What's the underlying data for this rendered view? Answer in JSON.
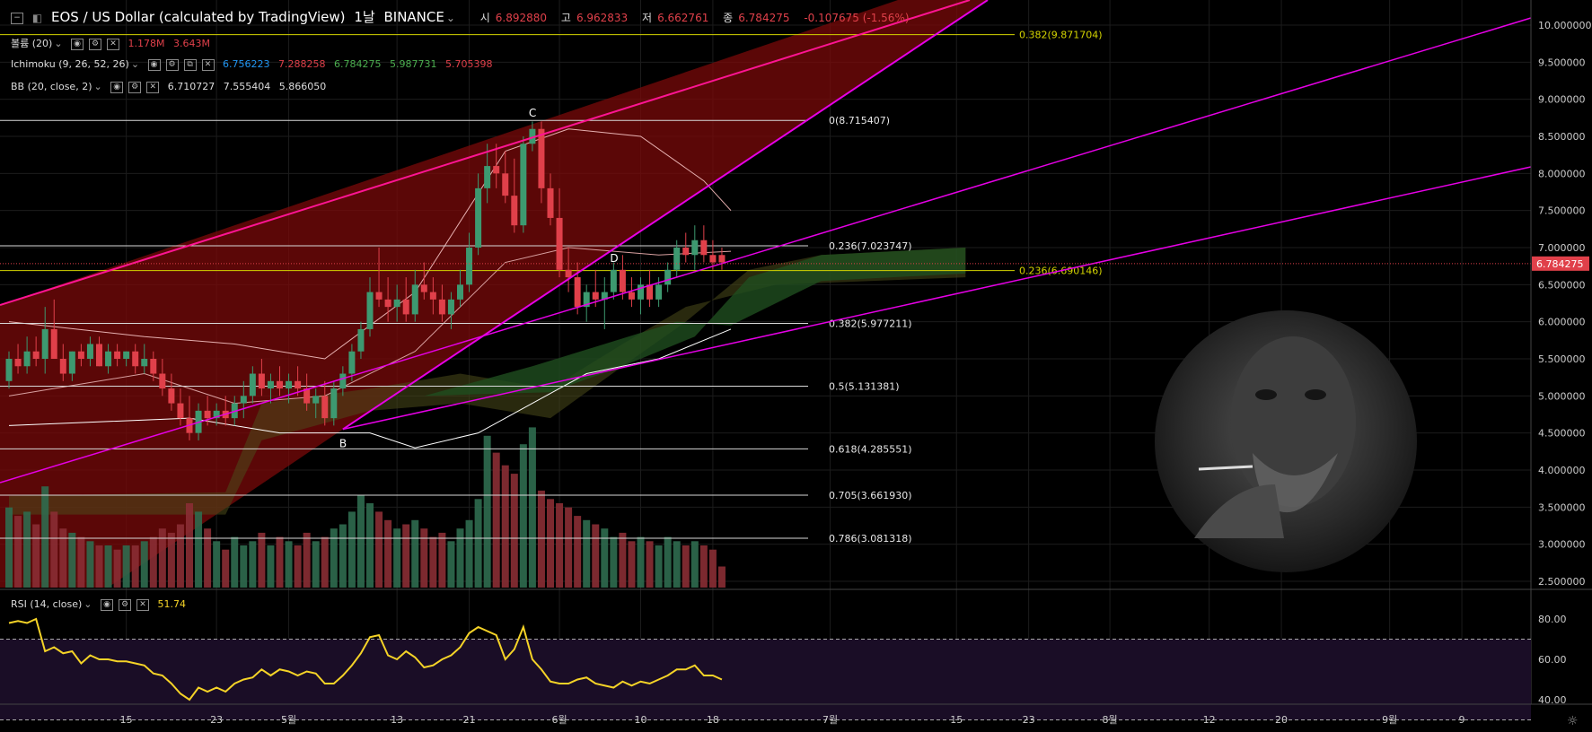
{
  "header": {
    "symbol": "EOS / US Dollar (calculated by TradingView)",
    "interval": "1날",
    "exchange": "BINANCE",
    "o_label": "시",
    "o_val": "6.892880",
    "h_label": "고",
    "h_val": "6.962833",
    "l_label": "저",
    "l_val": "6.662761",
    "c_label": "종",
    "c_val": "6.784275",
    "change": "-0.107675 (-1.56%)"
  },
  "indicators": {
    "volume_name": "볼륨 (20)",
    "volume_vals": [
      "1.178M",
      "3.643M"
    ],
    "ichimoku_name": "Ichimoku (9, 26, 52, 26)",
    "ichimoku_vals": [
      "6.756223",
      "7.288258",
      "6.784275",
      "5.987731",
      "5.705398"
    ],
    "bb_name": "BB (20, close, 2)",
    "bb_vals": [
      "6.710727",
      "7.555404",
      "5.866050"
    ],
    "rsi_name": "RSI (14, close)",
    "rsi_val": "51.74"
  },
  "colors": {
    "up": "#3d9970",
    "down": "#e0404a",
    "channel": "#ff1493",
    "trend": "#e600e6",
    "fib": "#d8d8d8",
    "fib2": "#d4d400",
    "rsi": "#f5d327",
    "ichi_cloud": "#1f4d1f",
    "price_tag": "#e0404a"
  },
  "chart_data": {
    "type": "candlestick",
    "price_axis": {
      "min": 2.5,
      "max": 10.0,
      "ticks": [
        "2.500000",
        "3.000000",
        "3.500000",
        "4.000000",
        "4.500000",
        "5.000000",
        "5.500000",
        "6.000000",
        "6.500000",
        "7.000000",
        "7.500000",
        "8.000000",
        "8.500000",
        "9.000000",
        "9.500000",
        "10.000000"
      ]
    },
    "time_axis": {
      "ticks": [
        {
          "label": "15",
          "i": 13
        },
        {
          "label": "23",
          "i": 23
        },
        {
          "label": "5월",
          "i": 31
        },
        {
          "label": "13",
          "i": 43
        },
        {
          "label": "21",
          "i": 51
        },
        {
          "label": "6월",
          "i": 61
        },
        {
          "label": "10",
          "i": 70
        },
        {
          "label": "18",
          "i": 78
        },
        {
          "label": "7월",
          "i": 91
        },
        {
          "label": "15",
          "i": 105
        },
        {
          "label": "23",
          "i": 113
        },
        {
          "label": "8월",
          "i": 122
        },
        {
          "label": "12",
          "i": 133
        },
        {
          "label": "20",
          "i": 141
        },
        {
          "label": "9월",
          "i": 153
        },
        {
          "label": "9",
          "i": 161
        }
      ]
    },
    "last_price": "6.784275",
    "candles": [
      [
        5.2,
        5.6,
        5.1,
        5.5
      ],
      [
        5.5,
        5.7,
        5.3,
        5.4
      ],
      [
        5.4,
        5.8,
        5.3,
        5.6
      ],
      [
        5.6,
        5.8,
        5.4,
        5.5
      ],
      [
        5.5,
        6.2,
        5.3,
        5.9
      ],
      [
        5.9,
        6.3,
        5.5,
        5.5
      ],
      [
        5.5,
        5.7,
        5.2,
        5.3
      ],
      [
        5.3,
        5.6,
        5.2,
        5.6
      ],
      [
        5.6,
        5.7,
        5.4,
        5.5
      ],
      [
        5.5,
        5.8,
        5.4,
        5.7
      ],
      [
        5.7,
        5.8,
        5.4,
        5.4
      ],
      [
        5.4,
        5.7,
        5.3,
        5.6
      ],
      [
        5.6,
        5.7,
        5.4,
        5.5
      ],
      [
        5.5,
        5.6,
        5.4,
        5.6
      ],
      [
        5.6,
        5.7,
        5.3,
        5.4
      ],
      [
        5.4,
        5.7,
        5.3,
        5.5
      ],
      [
        5.5,
        5.6,
        5.2,
        5.3
      ],
      [
        5.3,
        5.5,
        5.0,
        5.1
      ],
      [
        5.1,
        5.3,
        4.8,
        4.9
      ],
      [
        4.9,
        5.1,
        4.6,
        4.7
      ],
      [
        4.7,
        5.0,
        4.4,
        4.5
      ],
      [
        4.5,
        4.9,
        4.4,
        4.8
      ],
      [
        4.8,
        5.0,
        4.6,
        4.7
      ],
      [
        4.7,
        4.9,
        4.6,
        4.8
      ],
      [
        4.8,
        5.0,
        4.6,
        4.7
      ],
      [
        4.7,
        5.0,
        4.6,
        4.9
      ],
      [
        4.9,
        5.2,
        4.7,
        5.0
      ],
      [
        5.0,
        5.4,
        4.9,
        5.3
      ],
      [
        5.3,
        5.5,
        5.0,
        5.1
      ],
      [
        5.1,
        5.3,
        4.9,
        5.2
      ],
      [
        5.2,
        5.4,
        5.0,
        5.1
      ],
      [
        5.1,
        5.3,
        4.9,
        5.2
      ],
      [
        5.2,
        5.4,
        5.0,
        5.1
      ],
      [
        5.1,
        5.3,
        4.8,
        4.9
      ],
      [
        4.9,
        5.1,
        4.7,
        5.0
      ],
      [
        5.0,
        5.2,
        4.6,
        4.7
      ],
      [
        4.7,
        5.2,
        4.6,
        5.1
      ],
      [
        5.1,
        5.4,
        5.0,
        5.3
      ],
      [
        5.3,
        5.7,
        5.2,
        5.6
      ],
      [
        5.6,
        6.0,
        5.5,
        5.9
      ],
      [
        5.9,
        6.6,
        5.8,
        6.4
      ],
      [
        6.4,
        7.0,
        6.2,
        6.3
      ],
      [
        6.3,
        6.6,
        6.0,
        6.2
      ],
      [
        6.2,
        6.5,
        6.0,
        6.3
      ],
      [
        6.3,
        6.6,
        6.0,
        6.1
      ],
      [
        6.1,
        6.7,
        6.0,
        6.5
      ],
      [
        6.5,
        6.8,
        6.3,
        6.4
      ],
      [
        6.4,
        6.6,
        6.1,
        6.3
      ],
      [
        6.3,
        6.5,
        6.0,
        6.1
      ],
      [
        6.1,
        6.4,
        5.9,
        6.3
      ],
      [
        6.3,
        6.7,
        6.2,
        6.5
      ],
      [
        6.5,
        7.2,
        6.4,
        7.0
      ],
      [
        7.0,
        8.0,
        6.9,
        7.8
      ],
      [
        7.8,
        8.4,
        7.6,
        8.1
      ],
      [
        8.1,
        8.4,
        7.8,
        8.0
      ],
      [
        8.0,
        8.3,
        7.6,
        7.7
      ],
      [
        7.7,
        8.2,
        7.2,
        7.3
      ],
      [
        7.3,
        8.5,
        7.2,
        8.4
      ],
      [
        8.4,
        8.7,
        8.3,
        8.6
      ],
      [
        8.6,
        8.7,
        7.6,
        7.8
      ],
      [
        7.8,
        8.0,
        7.3,
        7.4
      ],
      [
        7.4,
        7.8,
        6.6,
        6.7
      ],
      [
        6.7,
        7.0,
        6.4,
        6.6
      ],
      [
        6.6,
        6.8,
        6.1,
        6.2
      ],
      [
        6.2,
        6.5,
        6.0,
        6.4
      ],
      [
        6.4,
        6.7,
        6.2,
        6.3
      ],
      [
        6.3,
        6.6,
        5.9,
        6.4
      ],
      [
        6.4,
        6.8,
        6.3,
        6.7
      ],
      [
        6.7,
        6.9,
        6.3,
        6.4
      ],
      [
        6.4,
        6.6,
        6.2,
        6.3
      ],
      [
        6.3,
        6.6,
        6.1,
        6.5
      ],
      [
        6.5,
        6.7,
        6.2,
        6.3
      ],
      [
        6.3,
        6.6,
        6.2,
        6.5
      ],
      [
        6.5,
        6.8,
        6.4,
        6.7
      ],
      [
        6.7,
        7.1,
        6.6,
        7.0
      ],
      [
        7.0,
        7.2,
        6.8,
        6.9
      ],
      [
        6.9,
        7.3,
        6.7,
        7.1
      ],
      [
        7.1,
        7.3,
        6.8,
        6.9
      ],
      [
        6.9,
        7.1,
        6.7,
        6.8
      ],
      [
        6.9,
        7.0,
        6.7,
        6.8
      ]
    ],
    "volume": [
      1.9,
      1.7,
      1.8,
      1.5,
      2.4,
      1.8,
      1.4,
      1.3,
      1.2,
      1.1,
      1.0,
      1.0,
      0.9,
      1.0,
      1.0,
      1.1,
      1.2,
      1.4,
      1.3,
      1.5,
      2.0,
      1.8,
      1.4,
      1.1,
      0.9,
      1.2,
      1.0,
      1.1,
      1.3,
      1.0,
      1.2,
      1.1,
      1.0,
      1.3,
      1.1,
      1.2,
      1.4,
      1.5,
      1.8,
      2.2,
      2.0,
      1.8,
      1.6,
      1.4,
      1.5,
      1.6,
      1.4,
      1.2,
      1.3,
      1.1,
      1.4,
      1.6,
      2.1,
      3.6,
      3.2,
      2.9,
      2.7,
      3.4,
      3.8,
      2.3,
      2.1,
      2.0,
      1.9,
      1.7,
      1.6,
      1.5,
      1.4,
      1.2,
      1.3,
      1.1,
      1.2,
      1.1,
      1.0,
      1.2,
      1.1,
      1.0,
      1.1,
      1.0,
      0.9,
      0.5
    ],
    "fibonacci_right": [
      {
        "label": "0(8.715407)",
        "price": 8.715407
      },
      {
        "label": "0.236(7.023747)",
        "price": 7.023747
      },
      {
        "label": "0.382(5.977211)",
        "price": 5.977211
      },
      {
        "label": "0.5(5.131381)",
        "price": 5.131381
      },
      {
        "label": "0.618(4.285551)",
        "price": 4.285551
      },
      {
        "label": "0.705(3.661930)",
        "price": 3.66193
      },
      {
        "label": "0.786(3.081318)",
        "price": 3.081318
      }
    ],
    "fibonacci_yellow": [
      {
        "label": "0.382(9.871704)",
        "price": 9.871704
      },
      {
        "label": "0.236(6.690146)",
        "price": 6.690146
      }
    ],
    "points": [
      {
        "label": "C",
        "i": 58,
        "price": 8.72
      },
      {
        "label": "B",
        "i": 37,
        "price": 4.48
      },
      {
        "label": "D",
        "i": 67,
        "price": 6.76
      }
    ],
    "rsi": {
      "ticks": [
        "80.00",
        "60.00",
        "40.00"
      ],
      "values": [
        78,
        79,
        78,
        80,
        64,
        66,
        63,
        64,
        58,
        62,
        60,
        60,
        59,
        59,
        58,
        57,
        53,
        52,
        48,
        43,
        40,
        46,
        44,
        46,
        44,
        48,
        50,
        51,
        55,
        52,
        55,
        54,
        52,
        54,
        53,
        48,
        48,
        52,
        57,
        63,
        71,
        72,
        62,
        60,
        64,
        61,
        56,
        57,
        60,
        62,
        66,
        73,
        76,
        74,
        72,
        60,
        65,
        76,
        60,
        55,
        49,
        48,
        48,
        50,
        51,
        48,
        47,
        46,
        49,
        47,
        49,
        48,
        50,
        52,
        55,
        55,
        57,
        52,
        52,
        50
      ]
    }
  }
}
